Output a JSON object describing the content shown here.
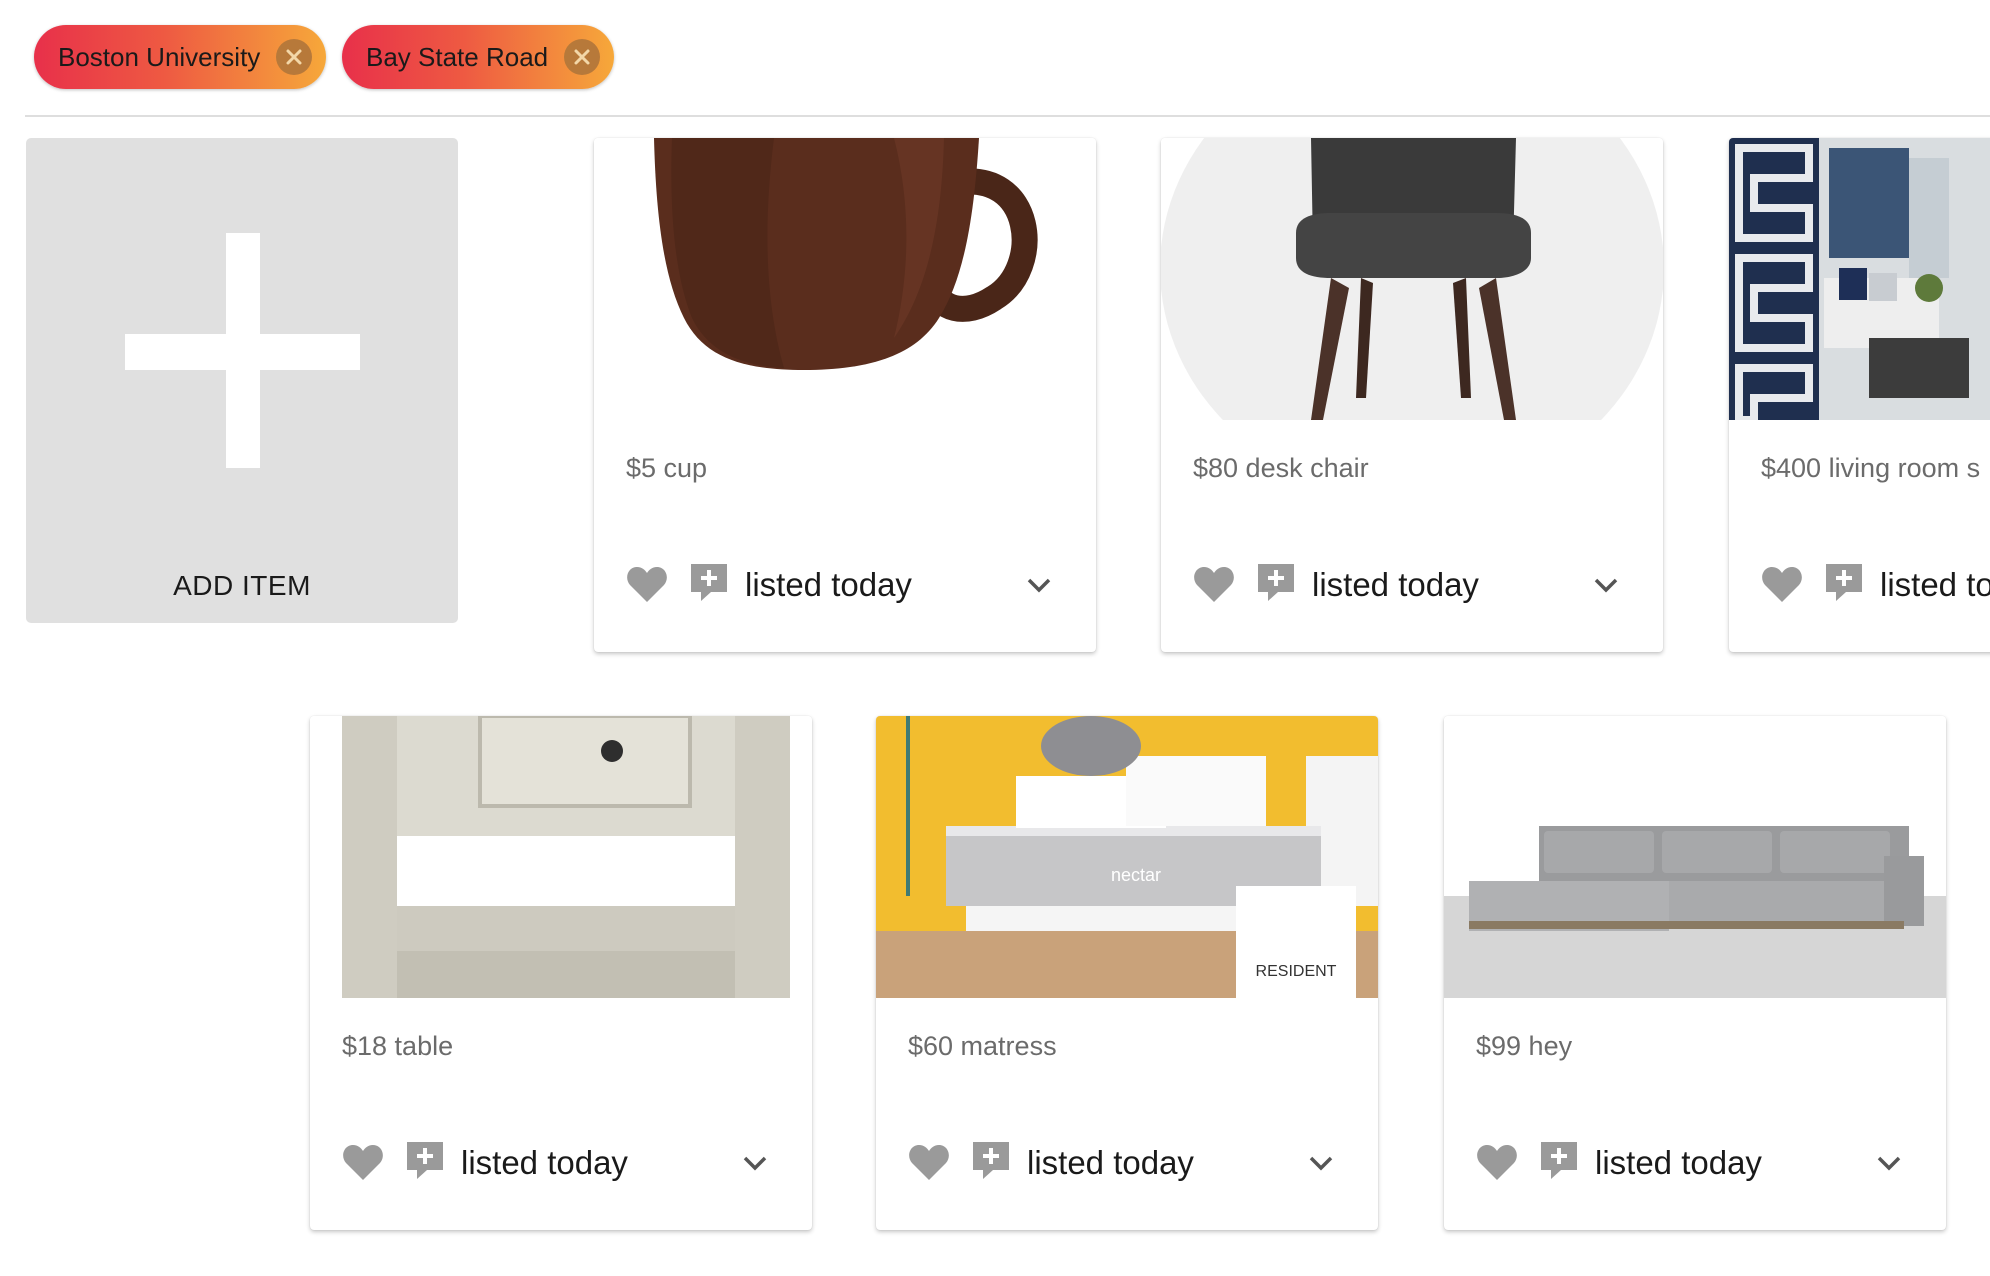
{
  "filters": [
    {
      "label": "Boston University"
    },
    {
      "label": "Bay State Road"
    }
  ],
  "add_item": {
    "label": "ADD ITEM"
  },
  "items": [
    {
      "title": "$5 cup",
      "listed": "listed today",
      "image": "brown-mug"
    },
    {
      "title": "$80 desk chair",
      "listed": "listed today",
      "image": "gray-chair"
    },
    {
      "title": "$400 living room s",
      "listed": "listed to",
      "image": "living-room"
    },
    {
      "title": "$18 table",
      "listed": "listed today",
      "image": "nightstand"
    },
    {
      "title": "$60 matress",
      "listed": "listed today",
      "image": "nectar-mattress"
    },
    {
      "title": "$99 hey",
      "listed": "listed today",
      "image": "gray-sectional"
    }
  ],
  "photo_text": {
    "mattress_brand": "nectar",
    "box_brand": "RESIDENT"
  },
  "icons": {
    "like": "heart-icon",
    "add": "add-to-list-icon",
    "expand": "chevron-down-icon",
    "remove": "close-icon"
  },
  "colors": {
    "chip_gradient_start": "#e8304a",
    "chip_gradient_end": "#f6a83a",
    "icon_gray": "#9a9a9a",
    "add_tile_bg": "#e0e0e0"
  }
}
